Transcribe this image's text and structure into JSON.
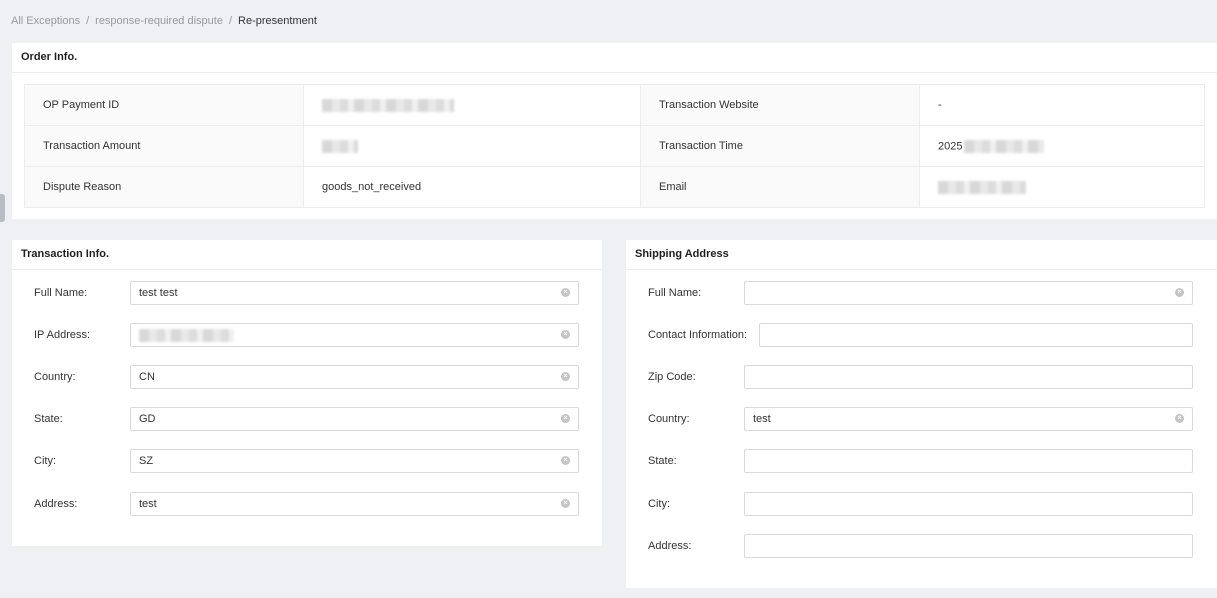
{
  "breadcrumb": {
    "item1": "All Exceptions",
    "item2": "response-required dispute",
    "current": "Re-presentment",
    "separator": "/"
  },
  "order_info": {
    "title": "Order Info.",
    "rows": [
      {
        "label1": "OP Payment ID",
        "value1": "",
        "label2": "Transaction Website",
        "value2": "-"
      },
      {
        "label1": "Transaction Amount",
        "value1": "",
        "label2": "Transaction Time",
        "value2": "2025"
      },
      {
        "label1": "Dispute Reason",
        "value1": "goods_not_received",
        "label2": "Email",
        "value2": ""
      }
    ]
  },
  "transaction_info": {
    "title": "Transaction Info.",
    "fields": [
      {
        "label": "Full Name:",
        "value": "test test",
        "clearable": true
      },
      {
        "label": "IP Address:",
        "value": "",
        "clearable": true
      },
      {
        "label": "Country:",
        "value": "CN",
        "clearable": true
      },
      {
        "label": "State:",
        "value": "GD",
        "clearable": true
      },
      {
        "label": "City:",
        "value": "SZ",
        "clearable": true
      },
      {
        "label": "Address:",
        "value": "test",
        "clearable": true
      }
    ]
  },
  "shipping_address": {
    "title": "Shipping Address",
    "fields": [
      {
        "label": "Full Name:",
        "value": "",
        "clearable": true
      },
      {
        "label": "Contact Information:",
        "value": "",
        "clearable": false
      },
      {
        "label": "Zip Code:",
        "value": "",
        "clearable": false
      },
      {
        "label": "Country:",
        "value": "test",
        "clearable": true
      },
      {
        "label": "State:",
        "value": "",
        "clearable": false
      },
      {
        "label": "City:",
        "value": "",
        "clearable": false
      },
      {
        "label": "Address:",
        "value": "",
        "clearable": false
      }
    ]
  },
  "icons": {
    "clear": "circle-x-icon"
  },
  "colors": {
    "background": "#eef0f3",
    "card": "#ffffff",
    "border": "#d9d9d9"
  }
}
